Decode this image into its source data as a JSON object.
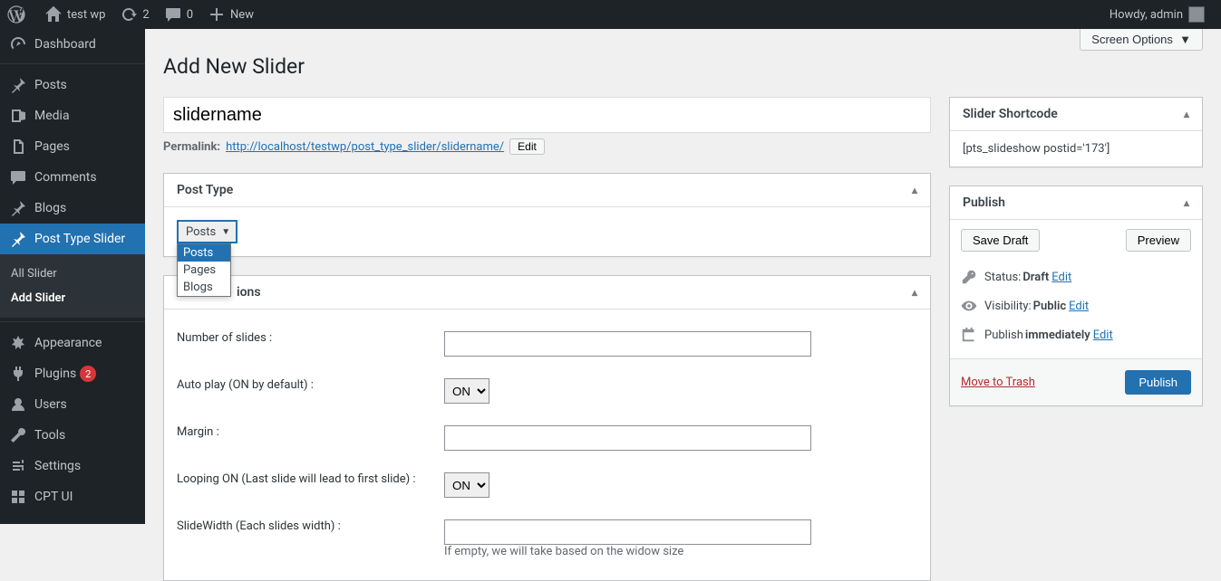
{
  "adminbar": {
    "site_name": "test wp",
    "updates": "2",
    "comments": "0",
    "new_label": "New",
    "howdy": "Howdy, admin"
  },
  "sidebar": {
    "items": [
      {
        "label": "Dashboard"
      },
      {
        "label": "Posts"
      },
      {
        "label": "Media"
      },
      {
        "label": "Pages"
      },
      {
        "label": "Comments"
      },
      {
        "label": "Blogs"
      },
      {
        "label": "Post Type Slider"
      },
      {
        "label": "Appearance"
      },
      {
        "label": "Plugins"
      },
      {
        "label": "Users"
      },
      {
        "label": "Tools"
      },
      {
        "label": "Settings"
      },
      {
        "label": "CPT UI"
      }
    ],
    "submenu": {
      "all": "All Slider",
      "add": "Add Slider"
    },
    "plugins_badge": "2"
  },
  "screen_options": "Screen Options",
  "page_title": "Add New Slider",
  "title_value": "slidername",
  "permalink": {
    "label": "Permalink:",
    "url": "http://localhost/testwp/post_type_slider/slidername/",
    "edit": "Edit"
  },
  "post_type_box": {
    "title": "Post Type",
    "selected": "Posts",
    "options": [
      "Posts",
      "Pages",
      "Blogs"
    ]
  },
  "slider_options": {
    "title_suffix": "ions",
    "fields": {
      "num_slides": {
        "label": "Number of slides :",
        "value": ""
      },
      "autoplay": {
        "label": "Auto play (ON by default) :",
        "value": "ON"
      },
      "margin": {
        "label": "Margin :",
        "value": ""
      },
      "looping": {
        "label": "Looping ON (Last slide will lead to first slide) :",
        "value": "ON"
      },
      "slidewidth": {
        "label": "SlideWidth (Each slides width) :",
        "value": "",
        "hint": "If empty, we will take based on the widow size"
      }
    }
  },
  "shortcode_box": {
    "title": "Slider Shortcode",
    "value": "[pts_slideshow postid='173']"
  },
  "publish_box": {
    "title": "Publish",
    "save_draft": "Save Draft",
    "preview": "Preview",
    "status_label": "Status:",
    "status_value": "Draft",
    "visibility_label": "Visibility:",
    "visibility_value": "Public",
    "publish_label": "Publish",
    "publish_value": "immediately",
    "edit": "Edit",
    "trash": "Move to Trash",
    "publish_btn": "Publish"
  }
}
